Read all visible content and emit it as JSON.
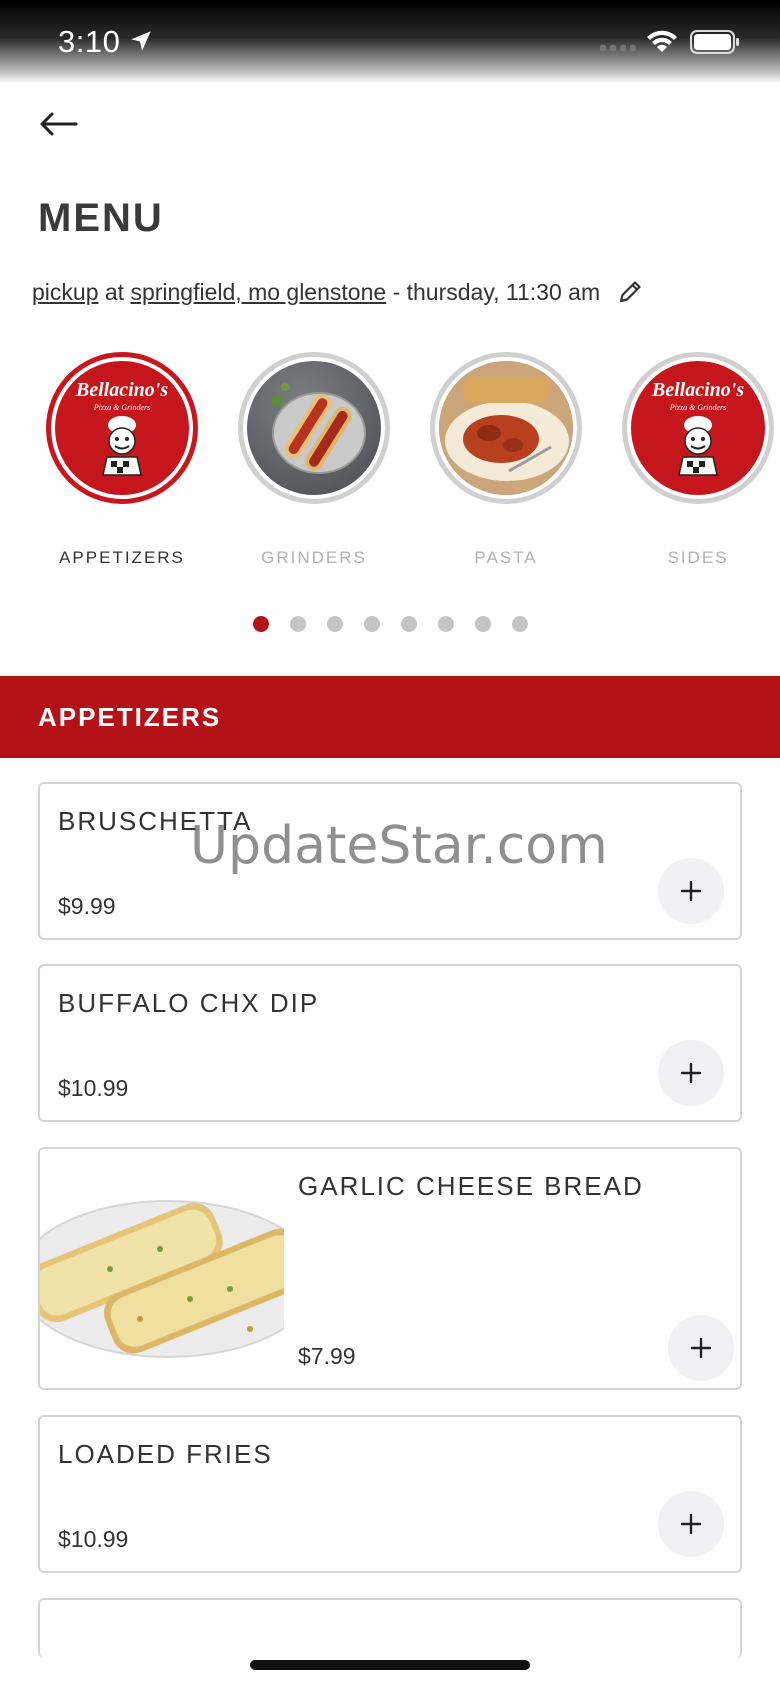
{
  "status_bar": {
    "time": "3:10",
    "icons": [
      "location-arrow-icon",
      "signal-icon",
      "wifi-icon",
      "battery-icon"
    ]
  },
  "header": {
    "back_icon": "arrow-left-icon",
    "title": "MENU"
  },
  "order_info": {
    "mode": "pickup",
    "at": "at",
    "location": "springfield, mo glenstone",
    "separator": "-",
    "time": "thursday, 11:30 am",
    "edit_icon": "pencil-icon"
  },
  "categories": [
    {
      "label": "APPETIZERS",
      "image": "bellacinos-logo",
      "active": true
    },
    {
      "label": "GRINDERS",
      "image": "grinder-sandwich-photo",
      "active": false
    },
    {
      "label": "PASTA",
      "image": "pasta-dish-photo",
      "active": false
    },
    {
      "label": "SIDES",
      "image": "bellacinos-logo",
      "active": false
    }
  ],
  "logo": {
    "name": "Bellacino's",
    "tagline": "Pizza & Grinders"
  },
  "carousel": {
    "page_count": 8,
    "active_index": 0
  },
  "section": {
    "title": "APPETIZERS"
  },
  "items": [
    {
      "name": "BRUSCHETTA",
      "price": "$9.99",
      "has_image": false
    },
    {
      "name": "BUFFALO CHX DIP",
      "price": "$10.99",
      "has_image": false
    },
    {
      "name": "GARLIC CHEESE BREAD",
      "price": "$7.99",
      "has_image": true,
      "image": "garlic-cheese-bread-photo"
    },
    {
      "name": "LOADED FRIES",
      "price": "$10.99",
      "has_image": false
    }
  ],
  "watermark": "UpdateStar.com",
  "colors": {
    "brand_red": "#b31217",
    "dot_inactive": "#c4c4c4",
    "card_border": "#d4d4d4"
  }
}
